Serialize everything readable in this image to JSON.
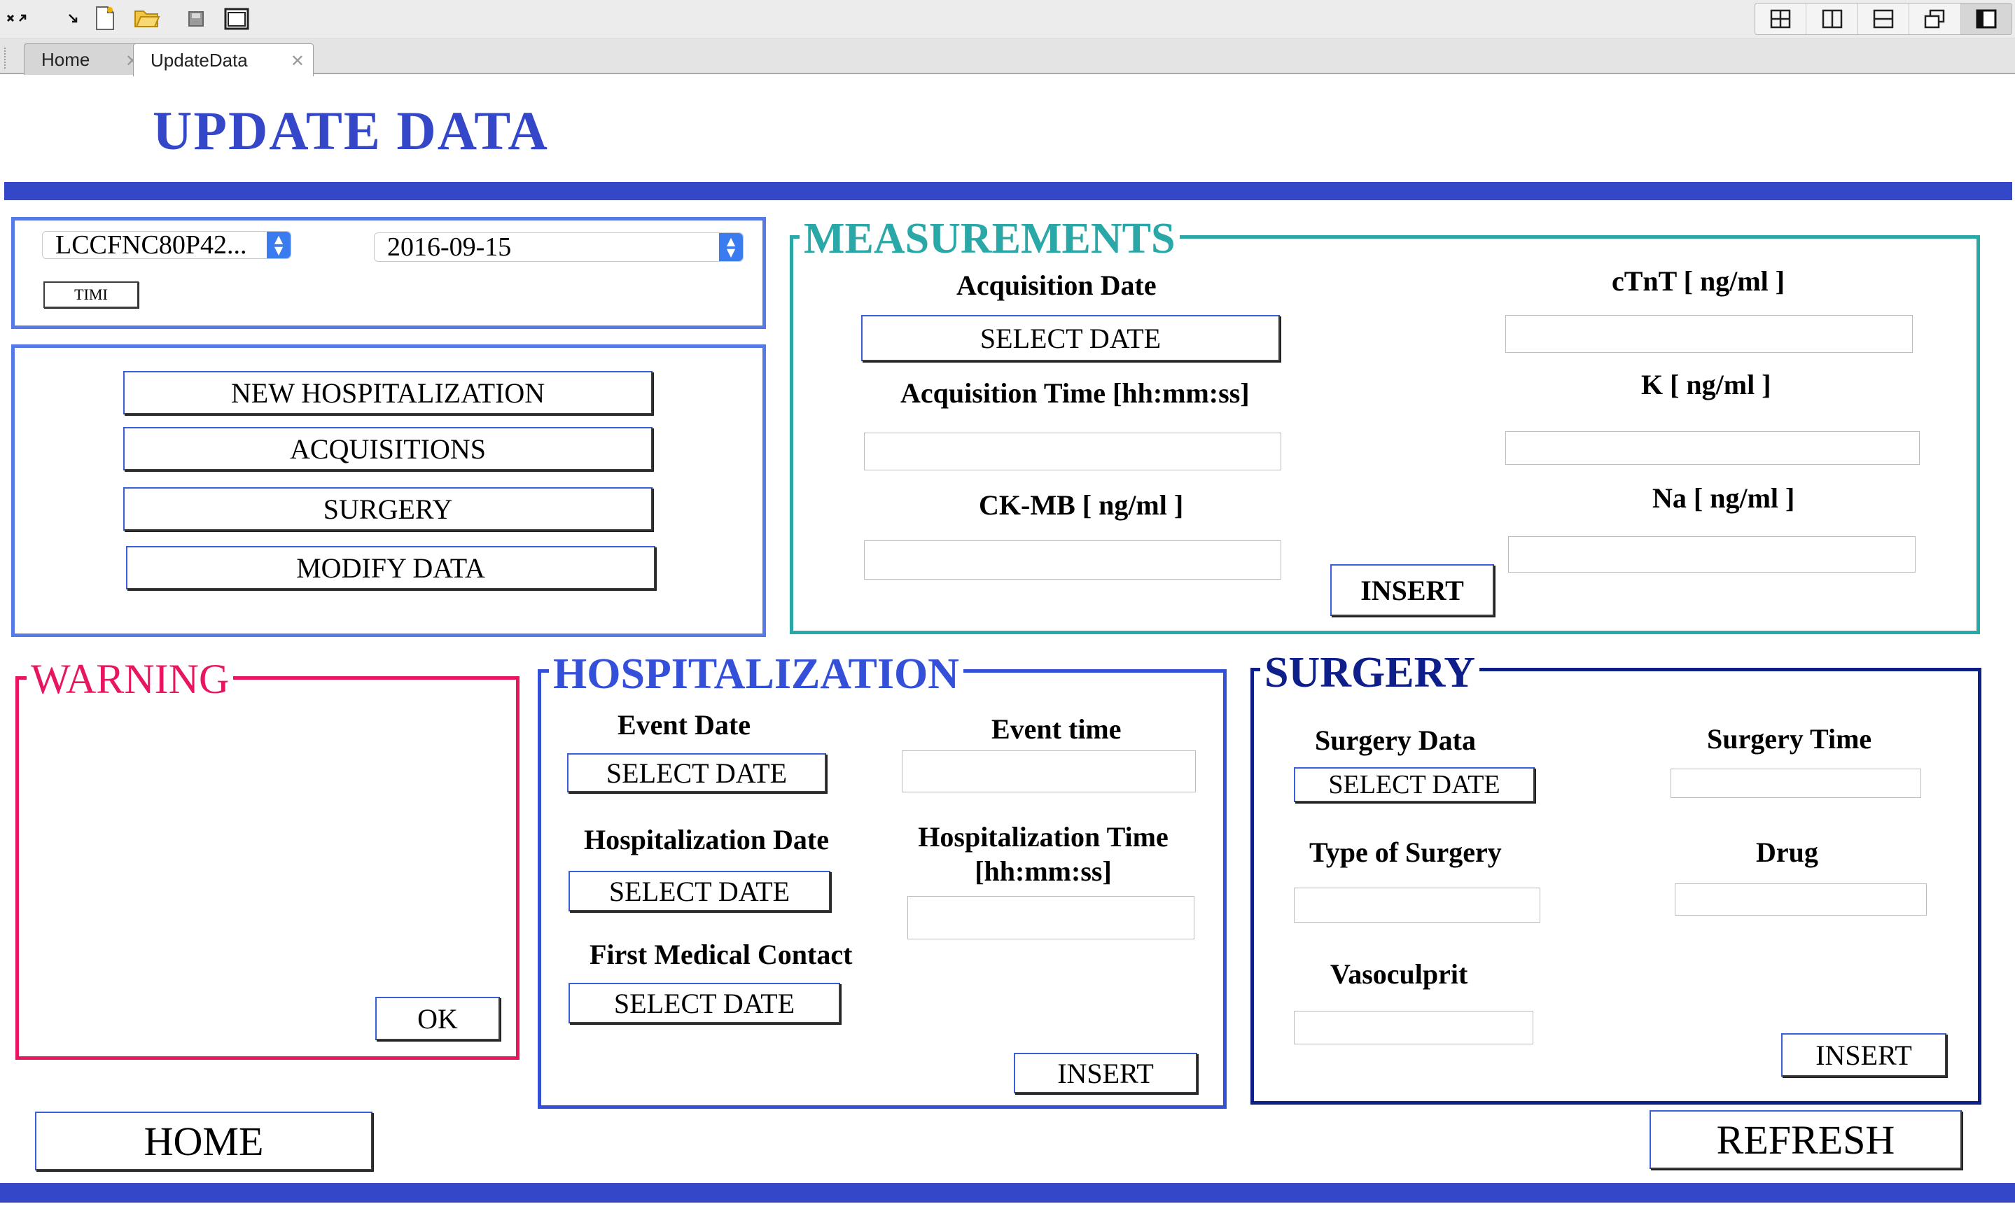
{
  "tabs": [
    {
      "label": "Home"
    },
    {
      "label": "UpdateData"
    }
  ],
  "page_title": "UPDATE DATA",
  "selector": {
    "patient_code": "LCCFNC80P42...",
    "date": "2016-09-15",
    "timi_label": "TIMI"
  },
  "actions": {
    "new_hospitalization": "NEW HOSPITALIZATION",
    "acquisitions": "ACQUISITIONS",
    "surgery": "SURGERY",
    "modify_data": "MODIFY DATA"
  },
  "measurements": {
    "title": "MEASUREMENTS",
    "acq_date_label": "Acquisition Date",
    "acq_date_button": "SELECT DATE",
    "acq_time_label": "Acquisition Time [hh:mm:ss]",
    "ckmb_label": "CK-MB [ ng/ml ]",
    "ctnt_label": "cTnT [ ng/ml ]",
    "k_label": "K [ ng/ml ]",
    "na_label": "Na [ ng/ml ]",
    "insert": "INSERT"
  },
  "warning": {
    "title": "WARNING",
    "ok": "OK"
  },
  "hospitalization": {
    "title": "HOSPITALIZATION",
    "event_date_label": "Event Date",
    "event_date_button": "SELECT DATE",
    "event_time_label": "Event time",
    "hosp_date_label": "Hospitalization Date",
    "hosp_date_button": "SELECT DATE",
    "hosp_time_label_1": "Hospitalization Time",
    "hosp_time_label_2": "[hh:mm:ss]",
    "fmc_label": "First Medical Contact",
    "fmc_button": "SELECT DATE",
    "insert": "INSERT"
  },
  "surgery": {
    "title": "SURGERY",
    "date_label": "Surgery Data",
    "date_button": "SELECT DATE",
    "time_label": "Surgery Time",
    "type_label": "Type of Surgery",
    "drug_label": "Drug",
    "vasoculprit_label": "Vasoculprit",
    "insert": "INSERT"
  },
  "footer": {
    "home": "HOME",
    "refresh": "REFRESH"
  },
  "colors": {
    "primary": "#3447c8",
    "panel_border": "#5579e6",
    "measurements": "#2aa8a8",
    "warning": "#e81560",
    "hospitalization": "#3450d8",
    "surgery": "#0f1f8a"
  }
}
